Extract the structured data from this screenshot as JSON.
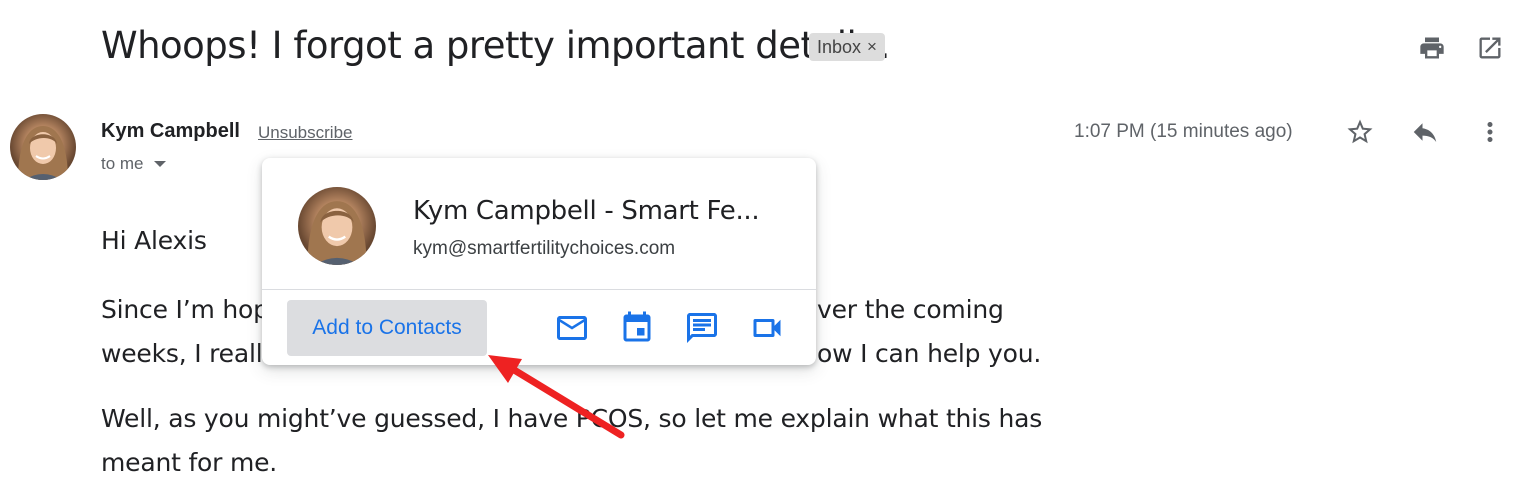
{
  "email": {
    "subject": "Whoops! I forgot a pretty important detail...",
    "label_chip": {
      "text": "Inbox",
      "remove": "×"
    },
    "sender": {
      "name": "Kym Campbell",
      "unsubscribe_label": "Unsubscribe",
      "recipient_label": "to me",
      "time": "1:07 PM (15 minutes ago)"
    },
    "body": {
      "greeting": "Hi Alexis",
      "para1_line1_left": "Since I’m hop",
      "para1_line1_right": "ver the coming",
      "para1_line2_left": "weeks, I reall",
      "para1_line2_right": "ow I can help you.",
      "para2_line1": "Well, as you might’ve guessed, I have PCOS, so let me explain what this has",
      "para2_line2": "meant for me."
    }
  },
  "contact_card": {
    "name": "Kym Campbell - Smart Fe...",
    "email": "kym@smartfertilitychoices.com",
    "add_button_label": "Add to Contacts",
    "actions": [
      "mail-icon",
      "calendar-icon",
      "chat-icon",
      "video-icon"
    ]
  },
  "toolbar": {
    "top_icons": [
      "print-icon",
      "open-in-new-window-icon"
    ],
    "message_icons": [
      "star-icon",
      "reply-icon",
      "more-vertical-icon"
    ]
  },
  "colors": {
    "accent_blue": "#1a73e8",
    "annotation_arrow": "#ee2222",
    "secondary_text": "#5f6368",
    "chip_background": "#dddddd"
  }
}
